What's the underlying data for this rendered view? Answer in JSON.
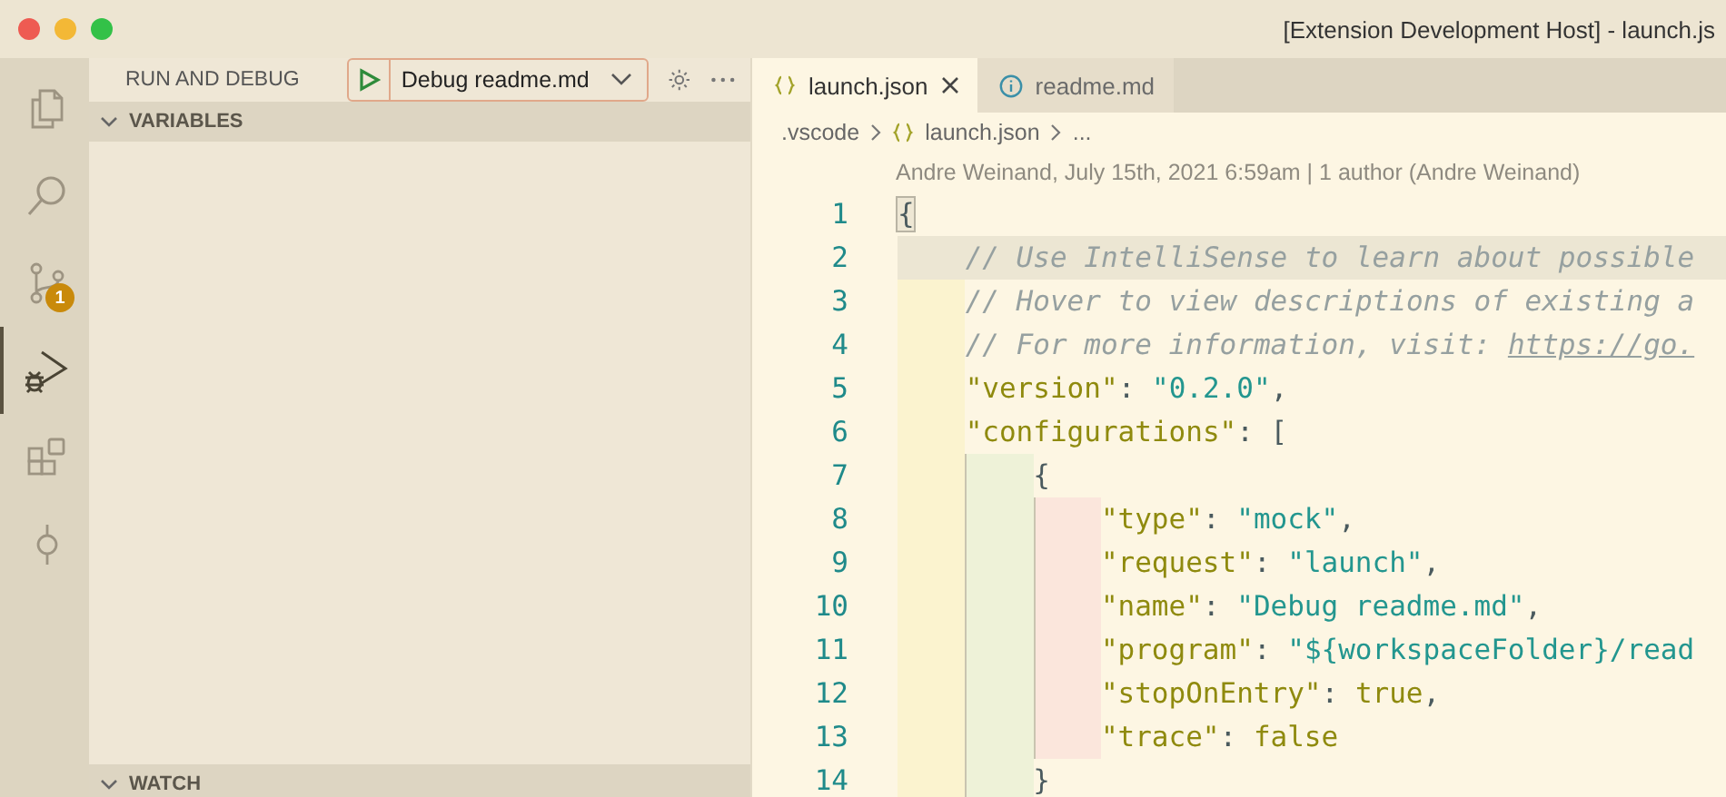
{
  "window": {
    "title": "[Extension Development Host] - launch.js"
  },
  "activity_bar": [
    {
      "kind": "files",
      "selected": false
    },
    {
      "kind": "search",
      "selected": false
    },
    {
      "kind": "scm",
      "selected": false,
      "badge": "1"
    },
    {
      "kind": "debug",
      "selected": true
    },
    {
      "kind": "extensions",
      "selected": false
    },
    {
      "kind": "commit",
      "selected": false
    }
  ],
  "sidebar": {
    "title": "RUN AND DEBUG",
    "launch_config": "Debug readme.md",
    "sections": [
      {
        "label": "VARIABLES",
        "expanded": true
      },
      {
        "label": "WATCH",
        "expanded": true
      }
    ]
  },
  "tabs": [
    {
      "label": "launch.json",
      "kind": "json",
      "selected": true
    },
    {
      "label": "readme.md",
      "kind": "info",
      "selected": false
    }
  ],
  "breadcrumb": [
    {
      "label": ".vscode",
      "kind": "folder"
    },
    {
      "label": "launch.json",
      "kind": "json"
    },
    {
      "label": "...",
      "kind": "symbol"
    }
  ],
  "blame": "Andre Weinand, July 15th, 2021 6:59am | 1 author (Andre Weinand)",
  "code": [
    {
      "number": "1",
      "current": false,
      "tokens": [
        {
          "kind": "bracket",
          "text": "{"
        }
      ]
    },
    {
      "number": "2",
      "current": true,
      "tokens": [
        {
          "kind": "comment",
          "text": "    // Use IntelliSense to learn about possible"
        }
      ]
    },
    {
      "number": "3",
      "current": false,
      "tokens": [
        {
          "kind": "comment",
          "text": "    // Hover to view descriptions of existing a"
        }
      ]
    },
    {
      "number": "4",
      "current": false,
      "tokens": [
        {
          "kind": "comment",
          "text": "    // For more information, visit: "
        },
        {
          "kind": "link",
          "text": "https://go."
        }
      ]
    },
    {
      "number": "5",
      "current": false,
      "tokens": [
        {
          "kind": "key",
          "text": "    \"version\""
        },
        {
          "kind": "punct",
          "text": ": "
        },
        {
          "kind": "string",
          "text": "\"0.2.0\""
        },
        {
          "kind": "punct",
          "text": ","
        }
      ]
    },
    {
      "number": "6",
      "current": false,
      "tokens": [
        {
          "kind": "key",
          "text": "    \"configurations\""
        },
        {
          "kind": "punct",
          "text": ": ["
        }
      ]
    },
    {
      "number": "7",
      "current": false,
      "tokens": [
        {
          "kind": "punct",
          "text": "        {"
        }
      ]
    },
    {
      "number": "8",
      "current": false,
      "tokens": [
        {
          "kind": "key",
          "text": "            \"type\""
        },
        {
          "kind": "punct",
          "text": ": "
        },
        {
          "kind": "string",
          "text": "\"mock\""
        },
        {
          "kind": "punct",
          "text": ","
        }
      ]
    },
    {
      "number": "9",
      "current": false,
      "tokens": [
        {
          "kind": "key",
          "text": "            \"request\""
        },
        {
          "kind": "punct",
          "text": ": "
        },
        {
          "kind": "string",
          "text": "\"launch\""
        },
        {
          "kind": "punct",
          "text": ","
        }
      ]
    },
    {
      "number": "10",
      "current": false,
      "tokens": [
        {
          "kind": "key",
          "text": "            \"name\""
        },
        {
          "kind": "punct",
          "text": ": "
        },
        {
          "kind": "string",
          "text": "\"Debug readme.md\""
        },
        {
          "kind": "punct",
          "text": ","
        }
      ]
    },
    {
      "number": "11",
      "current": false,
      "tokens": [
        {
          "kind": "key",
          "text": "            \"program\""
        },
        {
          "kind": "punct",
          "text": ": "
        },
        {
          "kind": "string",
          "text": "\"${workspaceFolder}/read"
        }
      ]
    },
    {
      "number": "12",
      "current": false,
      "tokens": [
        {
          "kind": "key",
          "text": "            \"stopOnEntry\""
        },
        {
          "kind": "punct",
          "text": ": "
        },
        {
          "kind": "bool",
          "text": "true"
        },
        {
          "kind": "punct",
          "text": ","
        }
      ]
    },
    {
      "number": "13",
      "current": false,
      "tokens": [
        {
          "kind": "key",
          "text": "            \"trace\""
        },
        {
          "kind": "punct",
          "text": ": "
        },
        {
          "kind": "bool",
          "text": "false"
        }
      ]
    },
    {
      "number": "14",
      "current": false,
      "tokens": [
        {
          "kind": "punct",
          "text": "        }"
        }
      ]
    }
  ]
}
